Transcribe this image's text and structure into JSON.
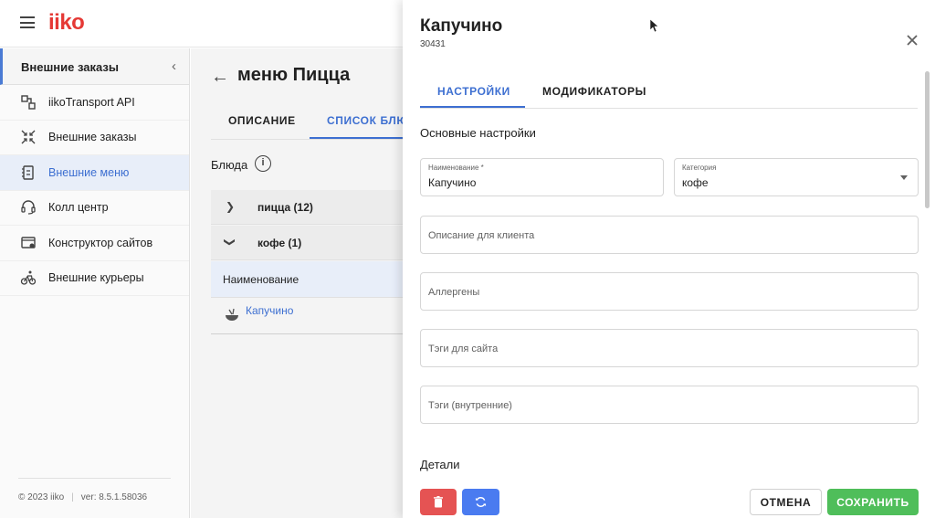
{
  "app": {
    "logo": "iiko"
  },
  "sidebar": {
    "header": "Внешние заказы",
    "items": [
      {
        "label": "iikoTransport API",
        "icon": "transport-api-icon"
      },
      {
        "label": "Внешние заказы",
        "icon": "orders-icon"
      },
      {
        "label": "Внешние меню",
        "icon": "menu-icon",
        "active": true
      },
      {
        "label": "Колл центр",
        "icon": "headset-icon"
      },
      {
        "label": "Конструктор сайтов",
        "icon": "site-builder-icon"
      },
      {
        "label": "Внешние курьеры",
        "icon": "courier-icon"
      }
    ],
    "footer": {
      "copyright": "© 2023 iiko",
      "version": "ver: 8.5.1.58036"
    }
  },
  "main": {
    "title": "меню Пицца",
    "tabs": [
      {
        "label": "ОПИСАНИЕ"
      },
      {
        "label": "СПИСОК БЛЮ",
        "active": true
      }
    ],
    "dishes_label": "Блюда",
    "info_glyph": "i",
    "groups": [
      {
        "label": "пицца (12)",
        "expanded": false
      },
      {
        "label": "кофе (1)",
        "expanded": true
      }
    ],
    "column_header": "Наименование",
    "items": [
      {
        "label": "Капучино"
      }
    ]
  },
  "panel": {
    "title": "Капучино",
    "code": "30431",
    "tabs": [
      {
        "label": "НАСТРОЙКИ",
        "active": true
      },
      {
        "label": "МОДИФИКАТОРЫ"
      }
    ],
    "basic_settings_heading": "Основные настройки",
    "fields": {
      "name": {
        "label": "Наименование *",
        "value": "Капучино"
      },
      "category": {
        "label": "Категория",
        "value": "кофе"
      },
      "description": {
        "placeholder": "Описание для клиента"
      },
      "allergens": {
        "placeholder": "Аллергены"
      },
      "site_tags": {
        "placeholder": "Тэги для сайта"
      },
      "internal_tags": {
        "placeholder": "Тэги (внутренние)"
      }
    },
    "details_heading": "Детали",
    "buttons": {
      "cancel": "ОТМЕНА",
      "save": "СОХРАНИТЬ"
    }
  },
  "colors": {
    "accent": "#3d6fd1",
    "brand": "#e53935",
    "delete": "#e55353",
    "refresh": "#4a7bf0",
    "save": "#4fbe5a"
  }
}
